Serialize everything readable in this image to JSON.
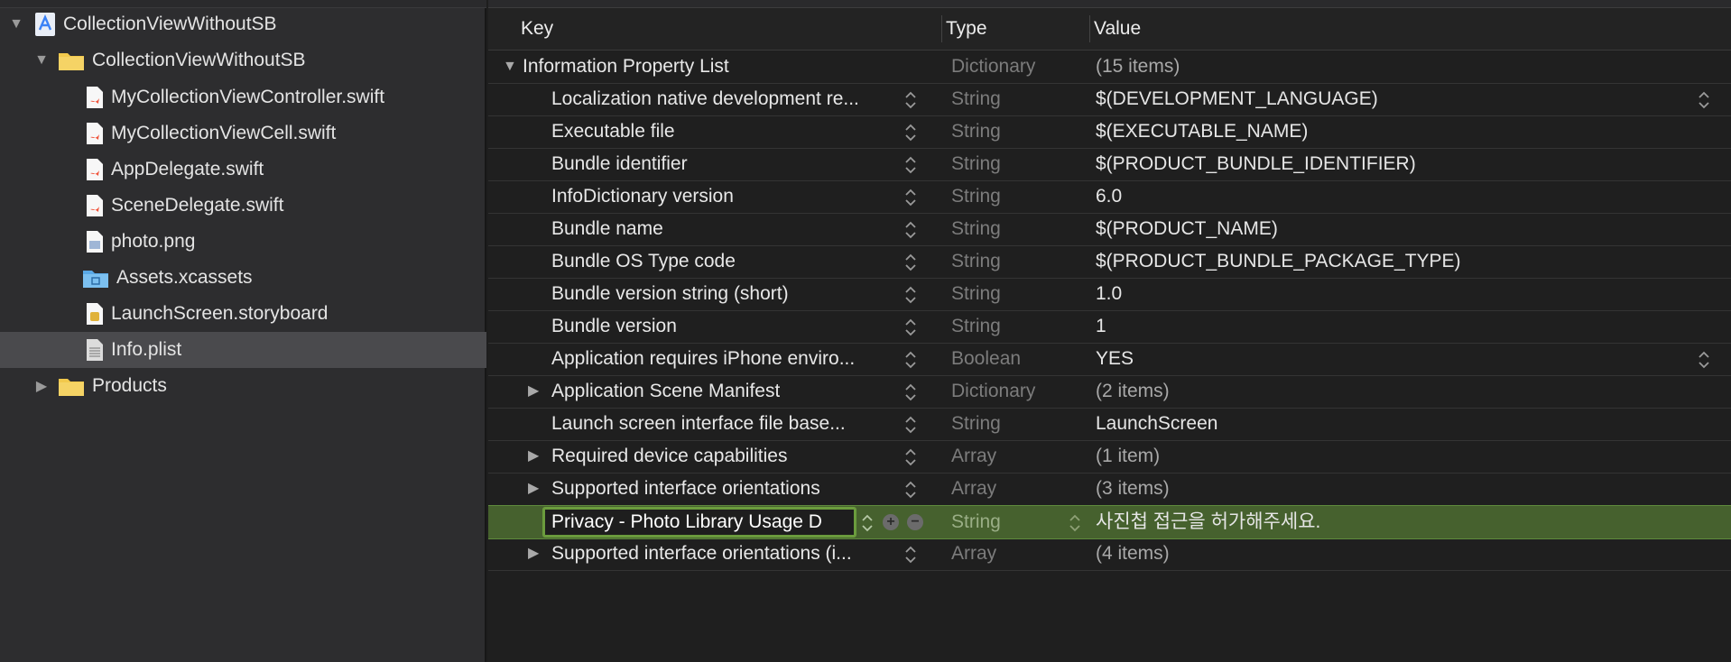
{
  "navigator": {
    "items": [
      {
        "label": "CollectionViewWithoutSB",
        "icon": "xcode-project-icon",
        "disclosure": "expanded"
      },
      {
        "label": "CollectionViewWithoutSB",
        "icon": "folder-icon",
        "disclosure": "expanded"
      },
      {
        "label": "MyCollectionViewController.swift",
        "icon": "swift-file-icon"
      },
      {
        "label": "MyCollectionViewCell.swift",
        "icon": "swift-file-icon"
      },
      {
        "label": "AppDelegate.swift",
        "icon": "swift-file-icon"
      },
      {
        "label": "SceneDelegate.swift",
        "icon": "swift-file-icon"
      },
      {
        "label": "photo.png",
        "icon": "image-file-icon"
      },
      {
        "label": "Assets.xcassets",
        "icon": "asset-catalog-icon"
      },
      {
        "label": "LaunchScreen.storyboard",
        "icon": "storyboard-file-icon"
      },
      {
        "label": "Info.plist",
        "icon": "plist-file-icon",
        "selected": true
      },
      {
        "label": "Products",
        "icon": "folder-icon",
        "disclosure": "collapsed"
      }
    ]
  },
  "editor": {
    "headers": {
      "key": "Key",
      "type": "Type",
      "value": "Value"
    },
    "rows": [
      {
        "key": "Information Property List",
        "type": "Dictionary",
        "value": "(15 items)",
        "disclosure": "expanded"
      },
      {
        "key": "Localization native development re...",
        "type": "String",
        "value": "$(DEVELOPMENT_LANGUAGE)"
      },
      {
        "key": "Executable file",
        "type": "String",
        "value": "$(EXECUTABLE_NAME)"
      },
      {
        "key": "Bundle identifier",
        "type": "String",
        "value": "$(PRODUCT_BUNDLE_IDENTIFIER)"
      },
      {
        "key": "InfoDictionary version",
        "type": "String",
        "value": "6.0"
      },
      {
        "key": "Bundle name",
        "type": "String",
        "value": "$(PRODUCT_NAME)"
      },
      {
        "key": "Bundle OS Type code",
        "type": "String",
        "value": "$(PRODUCT_BUNDLE_PACKAGE_TYPE)"
      },
      {
        "key": "Bundle version string (short)",
        "type": "String",
        "value": "1.0"
      },
      {
        "key": "Bundle version",
        "type": "String",
        "value": "1"
      },
      {
        "key": "Application requires iPhone enviro...",
        "type": "Boolean",
        "value": "YES"
      },
      {
        "key": "Application Scene Manifest",
        "type": "Dictionary",
        "value": "(2 items)",
        "disclosure": "collapsed"
      },
      {
        "key": "Launch screen interface file base...",
        "type": "String",
        "value": "LaunchScreen"
      },
      {
        "key": "Required device capabilities",
        "type": "Array",
        "value": "(1 item)",
        "disclosure": "collapsed"
      },
      {
        "key": "Supported interface orientations",
        "type": "Array",
        "value": "(3 items)",
        "disclosure": "collapsed"
      },
      {
        "key": "Privacy - Photo Library Usage D",
        "type": "String",
        "value": "사진첩 접근을 허가해주세요.",
        "editing": true
      },
      {
        "key": "Supported interface orientations (i...",
        "type": "Array",
        "value": "(4 items)",
        "disclosure": "collapsed"
      }
    ]
  },
  "colors": {
    "selection_row": "#46612e",
    "edit_border": "#6b9c3d",
    "folder": "#f2c94c",
    "swift": "#f05138",
    "project": "#3b82f6"
  }
}
